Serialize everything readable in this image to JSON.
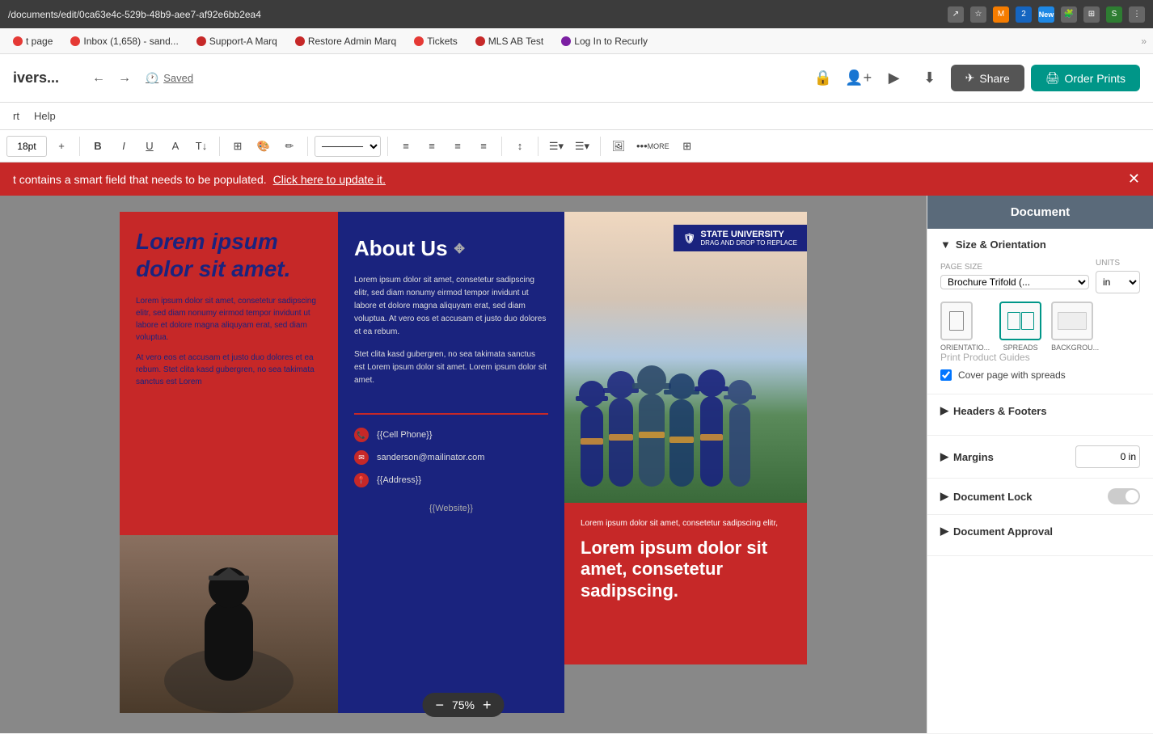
{
  "browser": {
    "url": "/documents/edit/0ca63e4c-529b-48b9-aee7-af92e6bb2ea4",
    "new_badge": "New"
  },
  "bookmarks": {
    "items": [
      {
        "label": "t page",
        "color": "#e53935"
      },
      {
        "label": "Inbox (1,658) - sand...",
        "color": "#e53935"
      },
      {
        "label": "Support-A Marq",
        "color": "#c62828"
      },
      {
        "label": "Restore Admin Marq",
        "color": "#c62828"
      },
      {
        "label": "Tickets",
        "color": "#e53935"
      },
      {
        "label": "MLS AB Test",
        "color": "#c62828"
      },
      {
        "label": "Log In to Recurly",
        "color": "#7b1fa2"
      }
    ]
  },
  "header": {
    "title": "ivers...",
    "menu_items": [
      "rt",
      "Help"
    ],
    "saved_label": "Saved",
    "share_label": "Share",
    "order_label": "Order Prints"
  },
  "toolbar": {
    "font_size": "18pt",
    "more_label": "MORE"
  },
  "alert": {
    "message": "t contains a smart field that needs to be populated.",
    "link_text": "Click here to update it."
  },
  "canvas": {
    "page_left": {
      "heading": "Lorem ipsum dolor sit amet.",
      "body1": "Lorem ipsum dolor sit amet, consetetur sadipscing elitr, sed diam nonumy eirmod tempor invidunt ut labore et dolore magna aliquyam erat, sed diam voluptua.",
      "body2": "At vero eos et accusam et justo duo dolores et ea rebum. Stet clita kasd gubergren, no sea takimata sanctus est Lorem"
    },
    "page_middle": {
      "title": "About Us",
      "body1": "Lorem ipsum dolor sit amet, consetetur sadipscing elitr, sed diam nonumy eirmod tempor invidunt ut labore et dolore magna aliquyam erat, sed diam voluptua. At vero eos et accusam et justo duo dolores et ea rebum.",
      "body2": "Stet clita kasd gubergren, no sea takimata sanctus est Lorem ipsum dolor sit amet. Lorem ipsum dolor sit amet.",
      "contact_phone": "{{Cell Phone}}",
      "contact_email": "sanderson@mailinator.com",
      "contact_address": "{{Address}}",
      "contact_website": "{{Website}}"
    },
    "page_right": {
      "university_name": "STATE UNIVERSITY",
      "drag_hint": "DRAG AND DROP TO REPLACE",
      "bottom_text": "Lorem ipsum dolor sit amet, consetetur sadipscing elitr,",
      "bottom_heading": "Lorem ipsum dolor sit amet, consetetur sadipscing."
    },
    "zoom": {
      "value": "75%"
    }
  },
  "right_panel": {
    "title": "Document",
    "size_section": {
      "label": "Size & Orientation",
      "page_size_label": "PAGE SIZE",
      "units_label": "UNITS",
      "size_value": "Brochure Trifold (...",
      "units_value": "in",
      "orientation_label": "ORIENTATIO...",
      "spreads_label": "SPREADS",
      "background_label": "BACKGROU...",
      "guide_label": "Print Product Guides",
      "cover_label": "Cover page with spreads"
    },
    "headers_section": {
      "label": "Headers & Footers"
    },
    "margins_section": {
      "label": "Margins",
      "value": "0 in"
    },
    "document_lock_section": {
      "label": "Document Lock"
    },
    "document_approval_section": {
      "label": "Document Approval"
    }
  }
}
